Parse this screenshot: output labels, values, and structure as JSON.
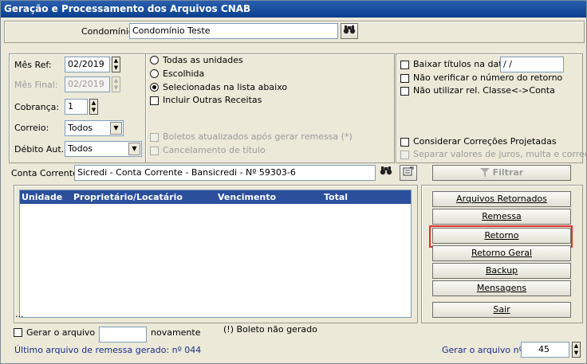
{
  "window": {
    "title": "Geração e Processamento dos Arquivos CNAB"
  },
  "condominio": {
    "label": "Condomínio:",
    "value": "Condomínio Teste"
  },
  "left": {
    "mes_ref_label": "Mês Ref:",
    "mes_ref_value": "02/2019",
    "mes_final_label": "Mês Final:",
    "mes_final_value": "02/2019",
    "cobranca_label": "Cobrança:",
    "cobranca_value": "1",
    "correio_label": "Correio:",
    "correio_value": "Todos",
    "debito_label": "Débito Aut.:",
    "debito_value": "Todos"
  },
  "middle": {
    "todas": "Todas as unidades",
    "escolhida": "Escolhida",
    "selecionadas": "Selecionadas na lista abaixo",
    "incluir": "Incluir Outras Receitas",
    "boletos_atualizados": "Boletos atualizados após gerar remessa (*)",
    "cancelamento": "Cancelamento de título"
  },
  "right": {
    "baixar": "Baixar títulos na data:",
    "baixar_value": " / /",
    "nao_verificar": "Não verificar o número do retorno",
    "nao_utilizar": "Não utilizar rel. Classe<->Conta",
    "considerar": "Considerar Correções Projetadas",
    "separar": "Separar valores de juros, multa e correção"
  },
  "conta": {
    "label": "Conta Corrente:",
    "value": "Sicredi - Conta Corrente - Bansicredi - Nº 59303-6"
  },
  "filtrar_label": "Filtrar",
  "list": {
    "col_unidade": "Unidade",
    "col_prop": "Proprietário/Locatário",
    "col_venc": "Vencimento",
    "col_total": "Total",
    "footer": "..."
  },
  "buttons": {
    "arquivos_retornados": "Arquivos Retornados",
    "remessa": "Remessa",
    "retorno": "Retorno",
    "retorno_geral": "Retorno Geral",
    "backup": "Backup",
    "mensagens": "Mensagens",
    "sair": "Sair"
  },
  "bottom": {
    "gerar_arquivo": "Gerar o arquivo",
    "gerar_value": "",
    "novamente": "novamente",
    "nota": "(!) Boleto não gerado",
    "ultimo": "Último arquivo de remessa gerado: nº 044",
    "gerar_n_label": "Gerar o arquivo nº:",
    "gerar_n_value": "45"
  },
  "icons": {
    "search": "binoculars-icon",
    "filter": "funnel-icon",
    "edit": "edit-icon"
  },
  "colors": {
    "titlebar": "#0b3f8f",
    "list_header": "#2b4f9b",
    "highlight": "#e03030",
    "info_text": "#1a2a8a"
  }
}
